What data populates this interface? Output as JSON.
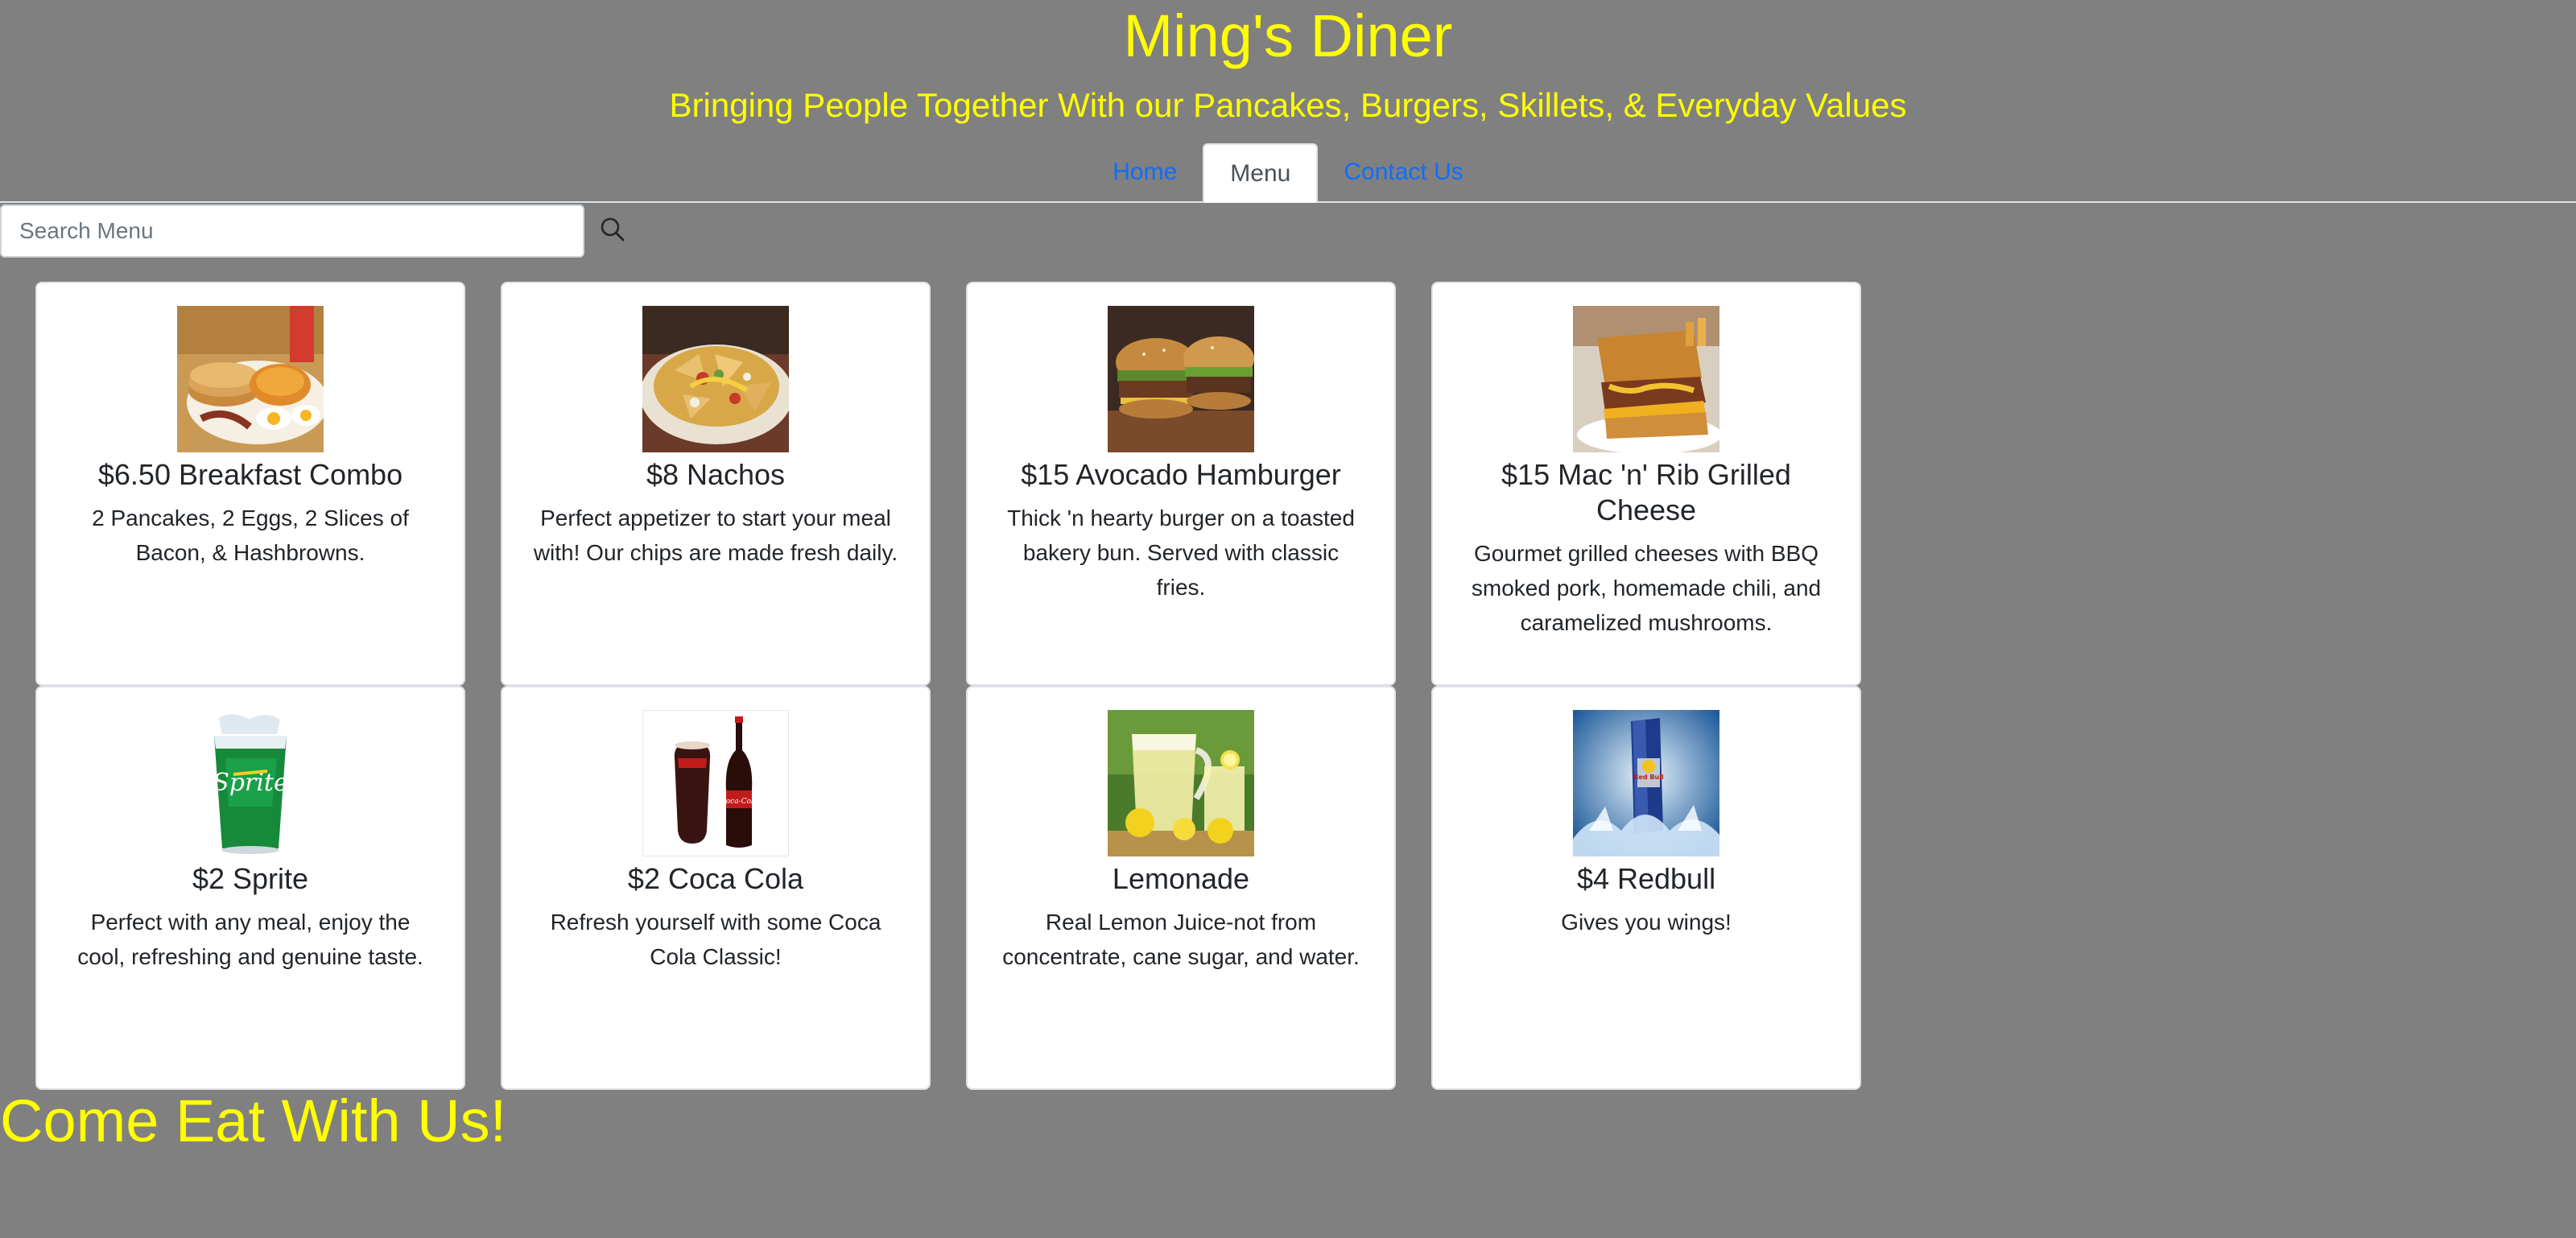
{
  "header": {
    "title": "Ming's Diner",
    "tagline": "Bringing People Together With our Pancakes, Burgers, Skillets, & Everyday Values"
  },
  "nav": {
    "tabs": [
      {
        "label": "Home",
        "active": false
      },
      {
        "label": "Menu",
        "active": true
      },
      {
        "label": "Contact Us",
        "active": false
      }
    ]
  },
  "search": {
    "placeholder": "Search Menu",
    "value": "",
    "icon": "search-icon"
  },
  "menu": {
    "items": [
      {
        "title": "$6.50 Breakfast Combo",
        "description": "2 Pancakes, 2 Eggs, 2 Slices of Bacon, & Hashbrowns.",
        "image": "breakfast-plate"
      },
      {
        "title": "$8 Nachos",
        "description": "Perfect appetizer to start your meal with! Our chips are made fresh daily.",
        "image": "nachos"
      },
      {
        "title": "$15 Avocado Hamburger",
        "description": "Thick 'n hearty burger on a toasted bakery bun. Served with classic fries.",
        "image": "hamburger"
      },
      {
        "title": "$15 Mac 'n' Rib Grilled Cheese",
        "description": "Gourmet grilled cheeses with BBQ smoked pork, homemade chili, and caramelized mushrooms.",
        "image": "grilled-cheese"
      },
      {
        "title": "$2 Sprite",
        "description": "Perfect with any meal, enjoy the cool, refreshing and genuine taste.",
        "image": "sprite-cup"
      },
      {
        "title": "$2 Coca Cola",
        "description": "Refresh yourself with some Coca Cola Classic!",
        "image": "coca-cola"
      },
      {
        "title": "Lemonade",
        "description": "Real Lemon Juice-not from concentrate, cane sugar, and water.",
        "image": "lemonade"
      },
      {
        "title": "$4 Redbull",
        "description": "Gives you wings!",
        "image": "redbull"
      }
    ]
  },
  "footer": {
    "text": "Come Eat With Us!"
  },
  "colors": {
    "background": "#808080",
    "heading": "#ffff00",
    "link": "#0d6efd",
    "card": "#ffffff"
  }
}
